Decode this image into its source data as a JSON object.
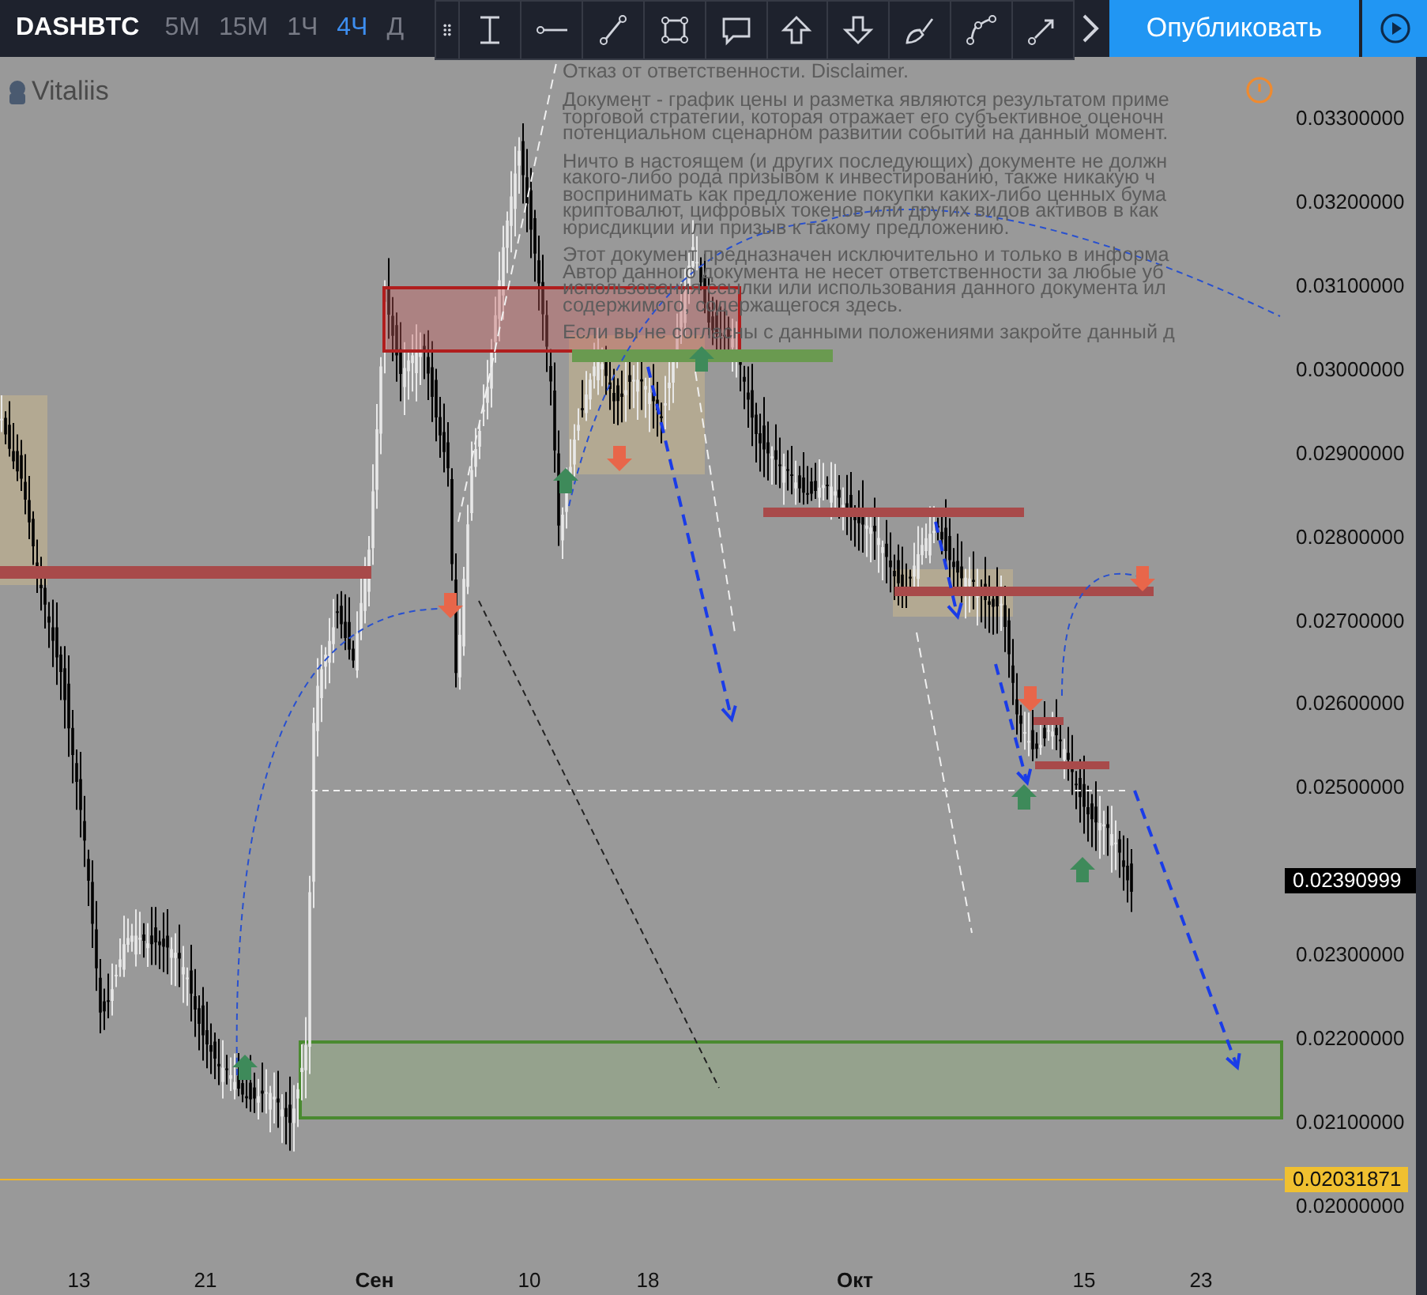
{
  "header": {
    "symbol": "DASHBTC",
    "intervals": [
      {
        "label": "5M",
        "selected": false
      },
      {
        "label": "15M",
        "selected": false
      },
      {
        "label": "1Ч",
        "selected": false
      },
      {
        "label": "4Ч",
        "selected": true
      },
      {
        "label": "Д",
        "selected": false
      }
    ],
    "publish_button": "Опубликовать"
  },
  "author": "Vitaliis",
  "disclaimer": {
    "title": "Отказ от ответственности. Disclaimer.",
    "paragraphs": [
      {
        "lines": [
          "Документ - график цены и разметка являются результатом приме",
          "торговой стратегии, которая отражает его субъективное оценочн",
          "потенциальном сценарном развитии событий на данный момент."
        ]
      },
      {
        "lines": [
          "Ничто в настоящем (и других последующих) документе не должн",
          "какого-либо рода призывом к инвестированию, также никакую ч",
          "воспринимать как предложение покупки каких-либо ценных бума",
          "криптовалют, цифровых токенов или других видов активов в как",
          "юрисдикции или призыв к такому предложению."
        ]
      },
      {
        "lines": [
          "Этот документ предназначен исключительно и только в информа",
          "Автор данного документа не несет ответственности за любые уб",
          "использования ссылки или использования данного документа ил",
          "содержимого, содержащегося здесь."
        ]
      },
      {
        "lines": [
          "Если вы не согласны с данными положениями закройте данный д"
        ]
      }
    ]
  },
  "price_axis": {
    "ticks": [
      "0.03300000",
      "0.03200000",
      "0.03100000",
      "0.03000000",
      "0.02900000",
      "0.02800000",
      "0.02700000",
      "0.02600000",
      "0.02500000",
      "0.02300000",
      "0.02200000",
      "0.02100000",
      "0.02000000"
    ],
    "last_price": "0.02390999",
    "marked_price": "0.02031871"
  },
  "time_axis": {
    "labels": [
      {
        "text": "13",
        "major": false
      },
      {
        "text": "21",
        "major": false
      },
      {
        "text": "Сен",
        "major": true
      },
      {
        "text": "10",
        "major": false
      },
      {
        "text": "18",
        "major": false
      },
      {
        "text": "Окт",
        "major": true
      },
      {
        "text": "15",
        "major": false
      },
      {
        "text": "23",
        "major": false
      }
    ]
  }
}
